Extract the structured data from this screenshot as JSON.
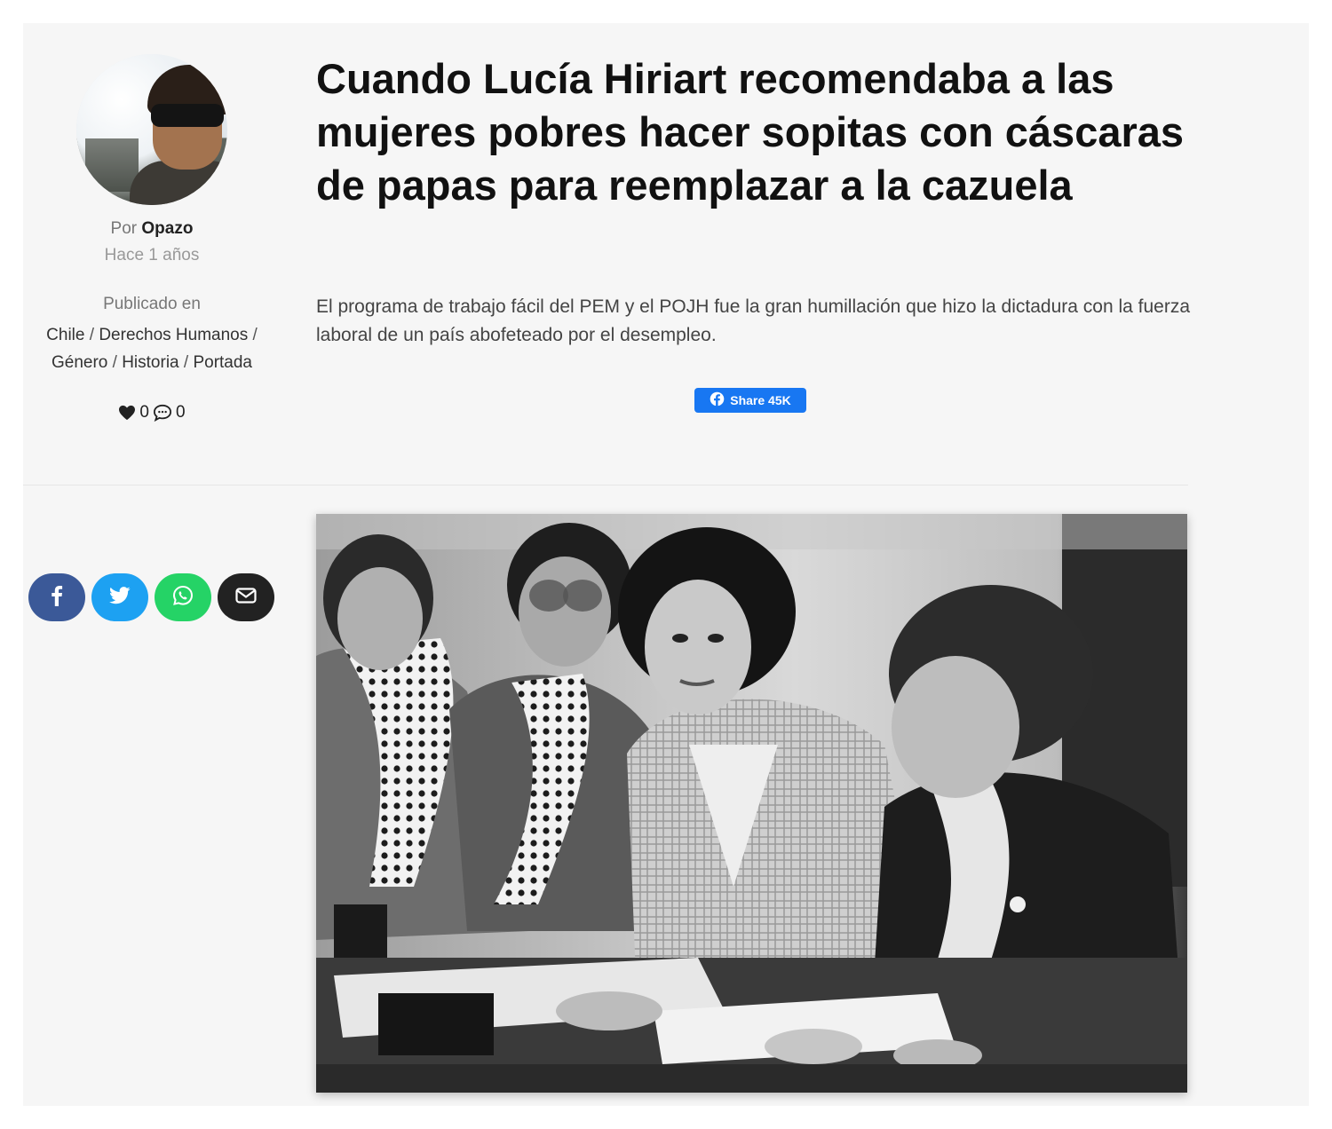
{
  "author": {
    "by_label": "Por",
    "name": "Opazo",
    "time_ago": "Hace 1 años"
  },
  "published": {
    "label": "Publicado en",
    "categories": [
      "Chile",
      "Derechos Humanos",
      "Género",
      "Historia",
      "Portada"
    ],
    "separator": " / "
  },
  "stats": {
    "likes": "0",
    "comments": "0"
  },
  "article": {
    "title": "Cuando Lucía Hiriart recomendaba a las mujeres pobres hacer sopitas con cáscaras de papas para reemplazar a la cazuela",
    "subtitle": "El programa de trabajo fácil del PEM y el POJH fue la gran humillación que hizo la dictadura con la fuerza laboral de un país abofeteado por el desempleo."
  },
  "fb_share": {
    "label": "Share 45K",
    "color": "#1877f2"
  },
  "share_buttons": [
    {
      "icon": "facebook-icon",
      "color": "#3b5998"
    },
    {
      "icon": "twitter-icon",
      "color": "#1da1f2"
    },
    {
      "icon": "whatsapp-icon",
      "color": "#25d366"
    },
    {
      "icon": "email-icon",
      "color": "#222222"
    }
  ],
  "colors": {
    "panel_bg": "#f6f6f6",
    "text": "#111111",
    "muted": "#888888"
  }
}
